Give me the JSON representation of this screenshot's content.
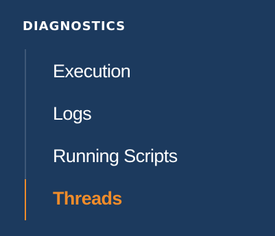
{
  "section": {
    "title": "DIAGNOSTICS"
  },
  "nav": {
    "items": [
      {
        "label": "Execution",
        "active": false
      },
      {
        "label": "Logs",
        "active": false
      },
      {
        "label": "Running Scripts",
        "active": false
      },
      {
        "label": "Threads",
        "active": true
      }
    ]
  },
  "colors": {
    "background": "#1c3a5e",
    "text": "#ffffff",
    "accent": "#f08c2a",
    "rail": "#3e5877"
  }
}
